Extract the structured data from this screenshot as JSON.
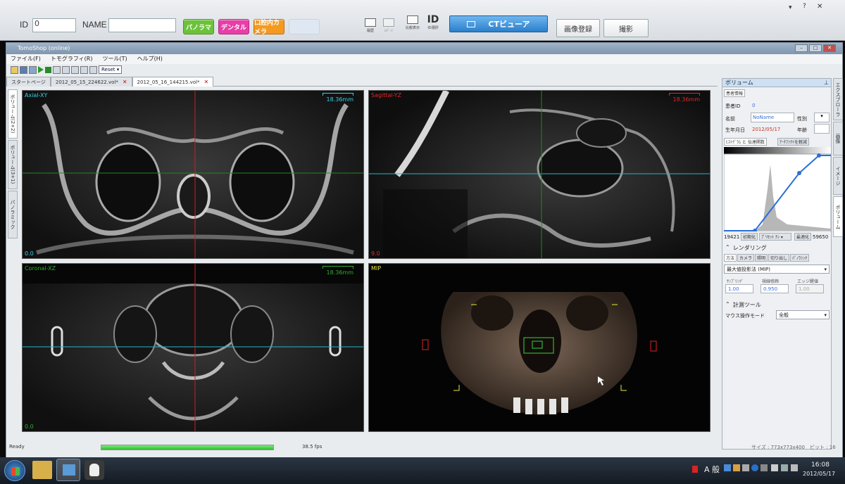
{
  "top_toolbar": {
    "id_label": "ID",
    "id_value": "0",
    "name_label": "NAME",
    "name_value": "",
    "buttons": [
      {
        "label": "パノラマ",
        "color": "#6cc23a"
      },
      {
        "label": "デンタル",
        "color": "#e83ea8"
      },
      {
        "label": "口腔内カメラ",
        "color": "#f59a1f"
      }
    ],
    "icon_buttons": [
      {
        "icon": "book-icon",
        "label": "履歴"
      },
      {
        "icon": "document-icon",
        "label": "ﾚﾎﾟｰﾄ"
      },
      {
        "icon": "compare-icon",
        "label": "比較表示"
      },
      {
        "icon": "id-icon",
        "label": "ID選択",
        "big": "ID"
      }
    ],
    "ct_viewer_label": "CTビューア",
    "register_label": "画像登録",
    "capture_label": "撮影"
  },
  "window": {
    "title": "TomoShop (online)",
    "menu": [
      "ファイル(F)",
      "トモグラフィ(R)",
      "ツール(T)",
      "ヘルプ(H)"
    ],
    "reset_label": "Reset",
    "tabs": [
      {
        "label": "スタートページ",
        "active": false,
        "closable": false
      },
      {
        "label": "2012_05_15_224622.vol*",
        "active": false,
        "closable": true
      },
      {
        "label": "2012_05_16_144215.vol*",
        "active": true,
        "closable": true
      }
    ],
    "left_tabs": [
      "ボリューム(2+2)",
      "ボリューム(3+1)",
      "パノラミック"
    ]
  },
  "viewports": [
    {
      "title": "Axial-XY",
      "title_color": "#35d4e6",
      "scale": "18.36mm",
      "scale_color": "#35d4e6",
      "corner": "0.0",
      "corner_color": "#35d4e6"
    },
    {
      "title": "Sagittal-YZ",
      "title_color": "#e02828",
      "scale": "18.36mm",
      "scale_color": "#e02828",
      "corner": "9.0",
      "corner_color": "#e02828"
    },
    {
      "title": "Coronal-XZ",
      "title_color": "#2fae2f",
      "scale": "18.36mm",
      "scale_color": "#2fae2f",
      "corner": "0.0",
      "corner_color": "#2fae2f"
    },
    {
      "title": "MIP",
      "title_color": "#e8e83a",
      "scale": "",
      "scale_color": "#e8e83a",
      "corner": "",
      "corner_color": "#e8e83a"
    }
  ],
  "right_panel": {
    "header": "ボリューム",
    "patient_tab": "患者情報",
    "patient_id_label": "患者ID",
    "patient_id": "0",
    "name_label": "名前",
    "name_value": "NoName",
    "sex_label": "性別",
    "dob_label": "生年月日",
    "dob_value": "2012/05/17",
    "age_label": "年齢",
    "histogram_tabs": [
      "ﾋｽﾄｸﾞﾗﾑ と 伝達関数",
      "ｱｰﾁﾌｧｸﾄを軽減"
    ],
    "hist_min": "19421",
    "init_label": "初期化",
    "preset_label": "ﾌﾟﾘｾｯﾄ ﾅｼ",
    "optimize_label": "最適化",
    "hist_max": "59650",
    "rendering_label": "レンダリング",
    "render_tabs": [
      "方法",
      "カメラ",
      "照明",
      "切り出し",
      "ﾊﾟﾉﾗﾐｯｸ"
    ],
    "method_value": "最大値投影法 (MIP)",
    "sampling_label": "ｻﾝﾌﾟﾘﾝｸﾞ",
    "sampling_value": "1.00",
    "ray_label": "視線修飾",
    "ray_value": "0.950",
    "edge_label": "エッジ醒値",
    "edge_value": "1.00",
    "measure_label": "計測ツール",
    "mouse_mode_label": "マウス操作モード",
    "mouse_mode_value": "全般",
    "side_tabs": [
      "エクスプローラ",
      "画像",
      "イメージ",
      "ボリューム"
    ]
  },
  "status": {
    "ready": "Ready",
    "fps": "38.5 fps",
    "progress": 1.0,
    "size": "サイズ : 773x773x400　ビット : 16"
  },
  "taskbar": {
    "ime": "A 般",
    "time": "16:08",
    "date": "2012/05/17"
  }
}
